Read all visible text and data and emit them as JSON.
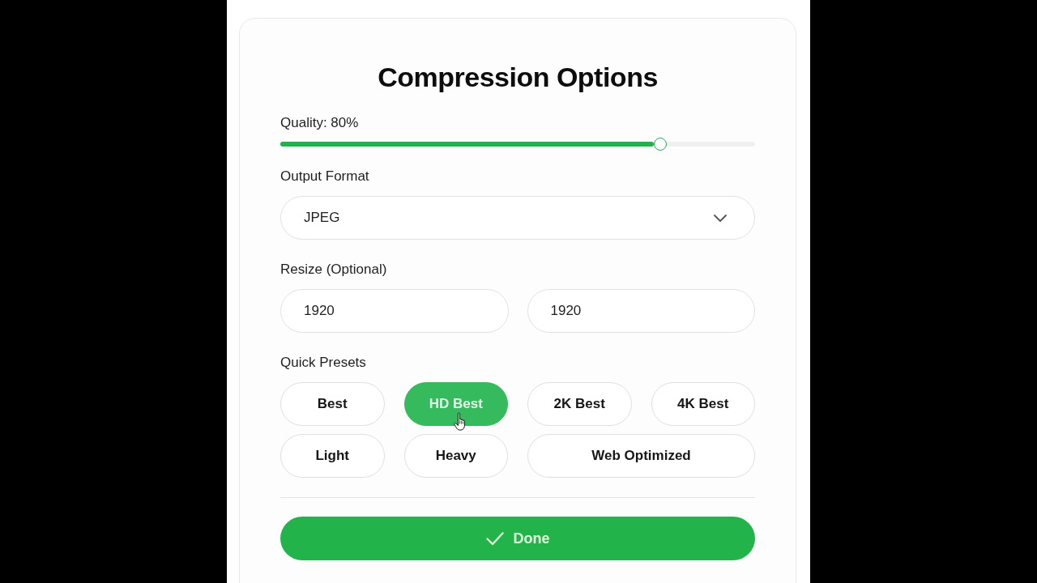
{
  "card": {
    "title": "Compression Options"
  },
  "quality": {
    "label": "Quality: 80%",
    "level": 0.8
  },
  "output_format": {
    "label": "Output Format",
    "value": "JPEG"
  },
  "resize": {
    "label": "Resize (Optional)",
    "fields": [
      {
        "value": "1920"
      },
      {
        "value": "1920"
      }
    ]
  },
  "presets": {
    "label": "Quick Presets",
    "items": [
      {
        "label": "Best",
        "selected": false
      },
      {
        "label": "HD Best",
        "selected": true
      },
      {
        "label": "2K Best",
        "selected": false
      },
      {
        "label": "4K Best",
        "selected": false
      },
      {
        "label": "Light",
        "selected": false
      },
      {
        "label": "Heavy",
        "selected": false
      },
      {
        "label": "Web Optimized",
        "selected": false
      }
    ]
  },
  "done_button": {
    "label": "Done"
  }
}
